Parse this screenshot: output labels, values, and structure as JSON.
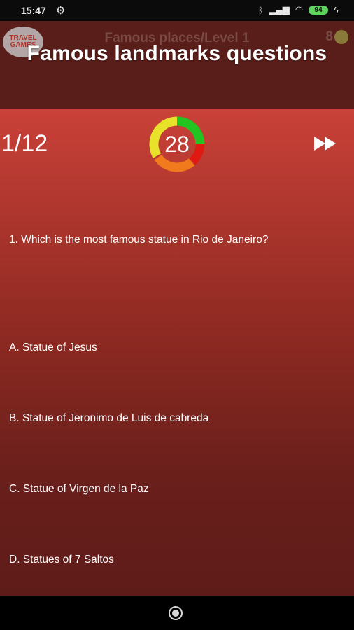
{
  "status_bar": {
    "time": "15:47",
    "battery": "94",
    "icons": [
      "settings-gear-icon",
      "bluetooth-icon",
      "signal-icon",
      "wifi-icon",
      "battery-icon",
      "charging-icon"
    ]
  },
  "header": {
    "logo_text": "TRAVEL GAMES",
    "title": "Famous places/Level 1",
    "coins": "8"
  },
  "banner": {
    "title": "Famous landmarks questions"
  },
  "quiz": {
    "progress": "1/12",
    "timer": "28",
    "timer_colors": [
      "#e8e32a",
      "#22c422",
      "#f07a1c",
      "#e01a12"
    ],
    "question": "1. Which is the most famous statue in Rio de Janeiro?",
    "answers": [
      "A. Statue of Jesus",
      "B. Statue of Jeronimo de Luis de cabreda",
      "C. Statue of Virgen de la Paz",
      "D. Statues of 7 Saltos"
    ]
  },
  "nav": {
    "home_icon": "home-circle-icon"
  }
}
